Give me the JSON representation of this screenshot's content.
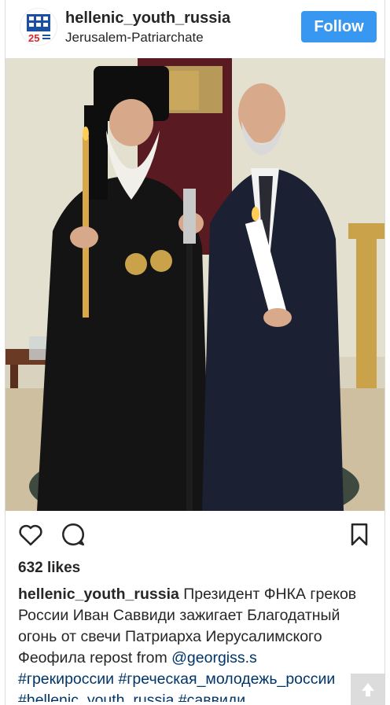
{
  "header": {
    "username": "hellenic_youth_russia",
    "location": "Jerusalem-Patriarchate",
    "follow_label": "Follow"
  },
  "post": {
    "likes": "632 likes",
    "caption": {
      "user": "hellenic_youth_russia",
      "text": "Президент ФНКА греков России Иван Саввиди зажигает Благодатный огонь от свечи Патриарха Иерусалимского Феофила repost from",
      "mention": "@georgiss.s",
      "hashtags_line1": "#грекироссии #греческая_молодежь_россии",
      "hashtags_line2": "#hellenic_youth_russia #саввиди"
    }
  },
  "avatar": {
    "badge": "25"
  },
  "icons": {
    "like": "heart-icon",
    "comment": "comment-icon",
    "save": "bookmark-icon",
    "scroll": "arrow-up-icon"
  },
  "colors": {
    "follow_bg": "#3897f0",
    "link": "#003569"
  }
}
